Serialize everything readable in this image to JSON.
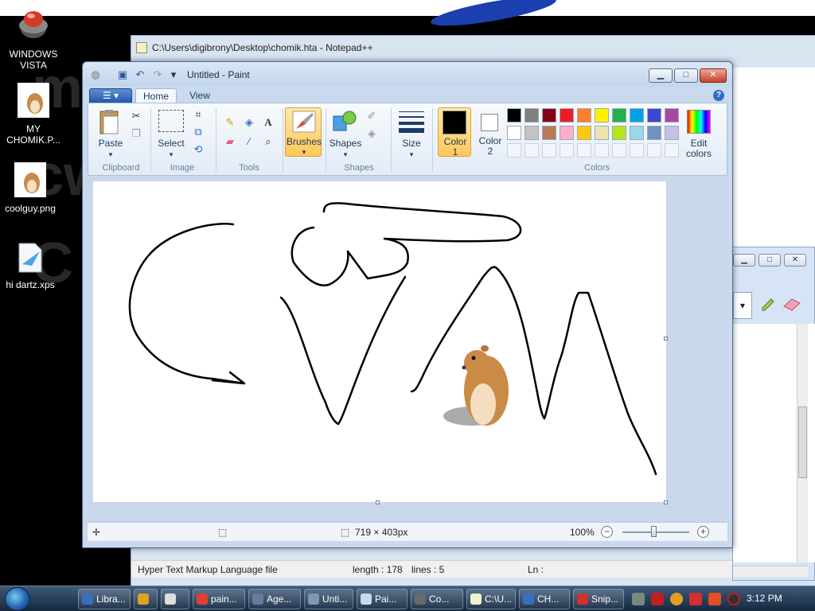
{
  "desktop": {
    "icons": [
      {
        "label": "WINDOWS VISTA"
      },
      {
        "label": "MY CHOMIK.P..."
      },
      {
        "label": "coolguy.png"
      },
      {
        "label": "hi dartz.xps"
      }
    ]
  },
  "notepad": {
    "title": "C:\\Users\\digibrony\\Desktop\\chomik.hta - Notepad++",
    "status": {
      "file_type": "Hyper Text Markup Language file",
      "length": "length : 178",
      "lines": "lines : 5",
      "ln": "Ln :"
    }
  },
  "paint": {
    "title": "Untitled - Paint",
    "tabs": {
      "home": "Home",
      "view": "View"
    },
    "groups": {
      "clipboard": "Clipboard",
      "image": "Image",
      "tools": "Tools",
      "shapes": "Shapes",
      "colors": "Colors"
    },
    "buttons": {
      "paste": "Paste",
      "select": "Select",
      "brushes": "Brushes",
      "shapes": "Shapes",
      "size": "Size",
      "color1_line1": "Color",
      "color1_line2": "1",
      "color2_line1": "Color",
      "color2_line2": "2",
      "edit_colors_line1": "Edit",
      "edit_colors_line2": "colors"
    },
    "palette_row1": [
      "#000000",
      "#7f7f7f",
      "#880015",
      "#ed1c24",
      "#ff7f27",
      "#fff200",
      "#22b14c",
      "#00a2e8",
      "#3f48cc",
      "#a349a4"
    ],
    "palette_row2": [
      "#ffffff",
      "#c3c3c3",
      "#b97a57",
      "#ffaec9",
      "#ffc90e",
      "#efe4b0",
      "#b5e61d",
      "#99d9ea",
      "#7092be",
      "#c8bfe7"
    ],
    "color1": "#000000",
    "color2": "#ffffff",
    "status": {
      "dimensions": "719 × 403px",
      "zoom": "100%"
    }
  },
  "taskbar": {
    "buttons": [
      {
        "label": "Libra..."
      },
      {
        "label": ""
      },
      {
        "label": ""
      },
      {
        "label": "pain..."
      },
      {
        "label": "Age..."
      },
      {
        "label": "Unti..."
      },
      {
        "label": "Pai..."
      },
      {
        "label": "Co..."
      },
      {
        "label": "C:\\U..."
      },
      {
        "label": "CH..."
      },
      {
        "label": "Snip..."
      }
    ],
    "clock": "3:12 PM"
  }
}
